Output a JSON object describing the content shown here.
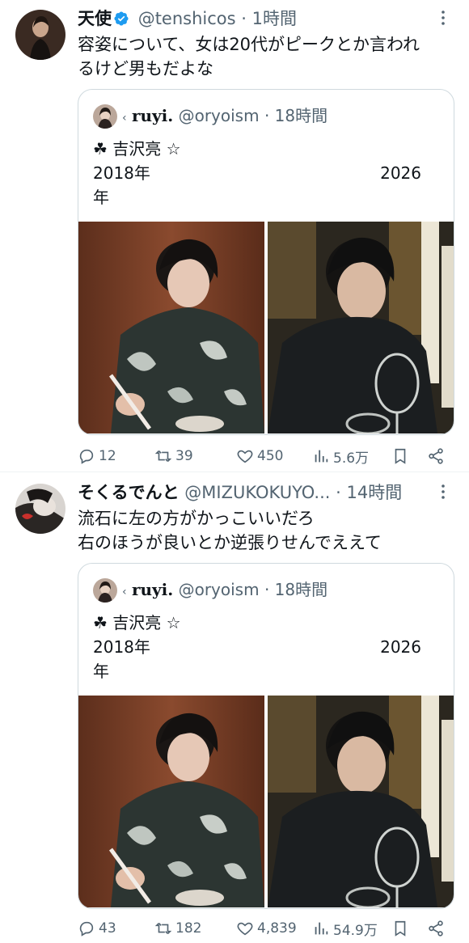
{
  "posts": [
    {
      "display_name": "天使",
      "handle": "@tenshicos",
      "dot": "·",
      "time": "1時間",
      "text": "容姿について、女は20代がピークとか言われ\nるけど男もだよな",
      "quote": {
        "name": "ruyi.",
        "handle": "@oryoism",
        "dot": "·",
        "time": "18時間",
        "line1": "☘ 吉沢亮 ☆",
        "left_text": "2018年",
        "right_text": "2026",
        "line3": "年"
      },
      "actions": {
        "replies": "12",
        "reposts": "39",
        "likes": "450",
        "views": "5.6万"
      }
    },
    {
      "display_name": "そくるでんと",
      "handle": "@MIZUKOKUYO...",
      "dot": "·",
      "time": "14時間",
      "text": "流石に左の方がかっこいいだろ\n右のほうが良いとか逆張りせんでええて",
      "quote": {
        "name": "ruyi.",
        "handle": "@oryoism",
        "dot": "·",
        "time": "18時間",
        "line1": "☘ 吉沢亮 ☆",
        "left_text": "2018年",
        "right_text": "2026",
        "line3": "年"
      },
      "actions": {
        "replies": "43",
        "reposts": "182",
        "likes": "4,839",
        "views": "54.9万"
      }
    }
  ],
  "icons": [
    "verified-badge-icon",
    "more-icon",
    "reply-icon",
    "repost-icon",
    "like-icon",
    "views-icon",
    "bookmark-icon",
    "share-icon"
  ],
  "colors": {
    "text": "#0f1419",
    "muted": "#536471",
    "verified": "#1d9bf0",
    "border": "#cfd9de"
  }
}
